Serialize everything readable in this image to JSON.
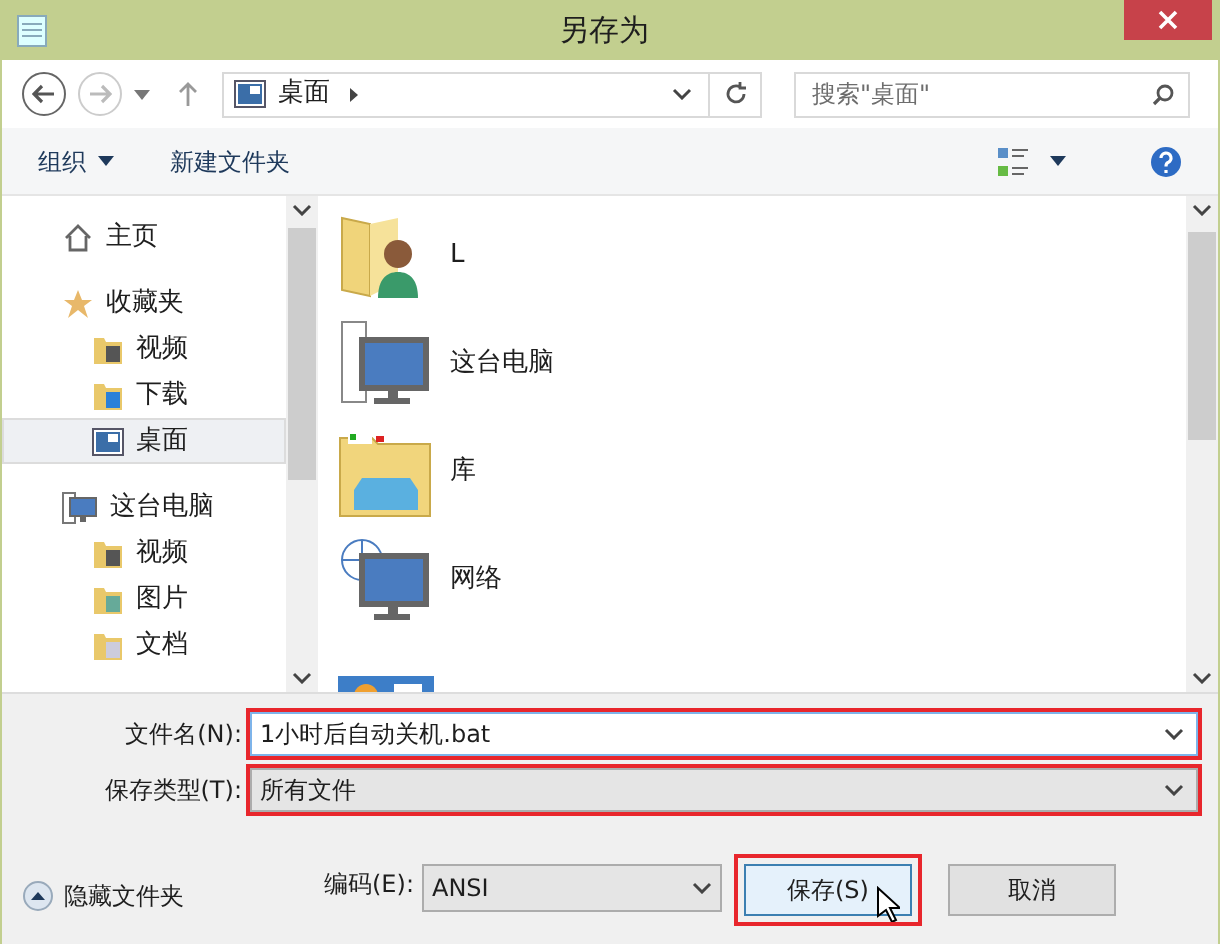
{
  "window": {
    "title": "另存为"
  },
  "address": {
    "crumbs": [
      "桌面"
    ]
  },
  "search": {
    "placeholder": "搜索\"桌面\""
  },
  "commands": [
    {
      "label": "组织",
      "dropdown": true
    },
    {
      "label": "新建文件夹",
      "dropdown": false
    }
  ],
  "sidebar": {
    "items": [
      {
        "label": "主页",
        "kind": "home",
        "selected": false
      },
      {
        "label": "收藏夹",
        "kind": "star",
        "selected": false,
        "children": [
          {
            "label": "视频",
            "kind": "video",
            "selected": false
          },
          {
            "label": "下载",
            "kind": "download",
            "selected": false
          },
          {
            "label": "桌面",
            "kind": "desktop",
            "selected": true
          }
        ]
      },
      {
        "label": "这台电脑",
        "kind": "pc",
        "selected": false,
        "children": [
          {
            "label": "视频",
            "kind": "video",
            "selected": false
          },
          {
            "label": "图片",
            "kind": "pictures",
            "selected": false
          },
          {
            "label": "文档",
            "kind": "documents",
            "selected": false
          }
        ]
      }
    ]
  },
  "files": [
    {
      "name": "L",
      "kind": "user"
    },
    {
      "name": "这台电脑",
      "kind": "pc"
    },
    {
      "name": "库",
      "kind": "library"
    },
    {
      "name": "网络",
      "kind": "network"
    },
    {
      "kind": "control-panel"
    }
  ],
  "filename": {
    "label": "文件名(N):",
    "value": "1小时后自动关机.bat",
    "highlighted": true
  },
  "filetype": {
    "label": "保存类型(T):",
    "value": "所有文件",
    "highlighted": true
  },
  "hide_folders": {
    "label": "隐藏文件夹"
  },
  "encoding": {
    "label": "编码(E):",
    "value": "ANSI"
  },
  "buttons": [
    {
      "label": "保存(S)",
      "highlighted": true,
      "primary": true
    },
    {
      "label": "取消",
      "primary": false
    }
  ]
}
